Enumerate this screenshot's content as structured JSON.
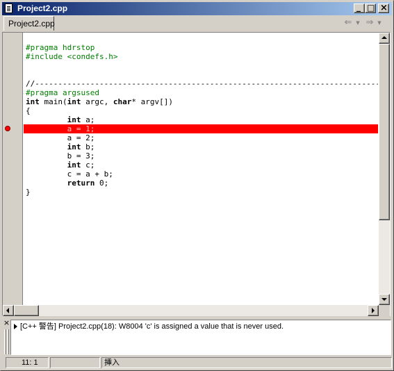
{
  "window": {
    "title": "Project2.cpp",
    "minimize_glyph": "_",
    "maximize_glyph": "□",
    "close_glyph": "×"
  },
  "tabs": [
    {
      "label": "Project2.cpp",
      "active": true
    }
  ],
  "nav": {
    "back_icon": "arrow-left-icon",
    "forward_icon": "arrow-right-icon",
    "back_glyph": "⇐",
    "forward_glyph": "⇒",
    "dropdown_glyph": "▼"
  },
  "editor": {
    "lines": [
      {
        "text": "",
        "style": "normal"
      },
      {
        "text": "#pragma hdrstop",
        "style": "directive"
      },
      {
        "text": "#include <condefs.h>",
        "style": "directive"
      },
      {
        "text": "",
        "style": "normal"
      },
      {
        "text": "",
        "style": "normal"
      },
      {
        "text": "//---------------------------------------------------------------------------",
        "style": "comment"
      },
      {
        "text": "#pragma argsused",
        "style": "directive"
      },
      {
        "text": "int main(int argc, char* argv[])",
        "style": "code"
      },
      {
        "text": "{",
        "style": "code"
      },
      {
        "text": "         int a;",
        "style": "code"
      },
      {
        "text": "         a = 1;",
        "style": "breakpoint"
      },
      {
        "text": "         a = 2;",
        "style": "code"
      },
      {
        "text": "         int b;",
        "style": "code"
      },
      {
        "text": "         b = 3;",
        "style": "code"
      },
      {
        "text": "         int c;",
        "style": "code"
      },
      {
        "text": "         c = a + b;",
        "style": "code"
      },
      {
        "text": "         return 0;",
        "style": "code"
      },
      {
        "text": "}",
        "style": "code"
      }
    ],
    "breakpoint_line": 11,
    "breakpoint_color": "#ff0000",
    "directive_color": "#008000"
  },
  "messages": [
    {
      "category": "[C++ 警告]",
      "text": "[C++ 警告] Project2.cpp(18): W8004 'c' is assigned a value that is never used."
    }
  ],
  "status": {
    "position": "11:   1",
    "modified": "",
    "mode": "挿入"
  }
}
